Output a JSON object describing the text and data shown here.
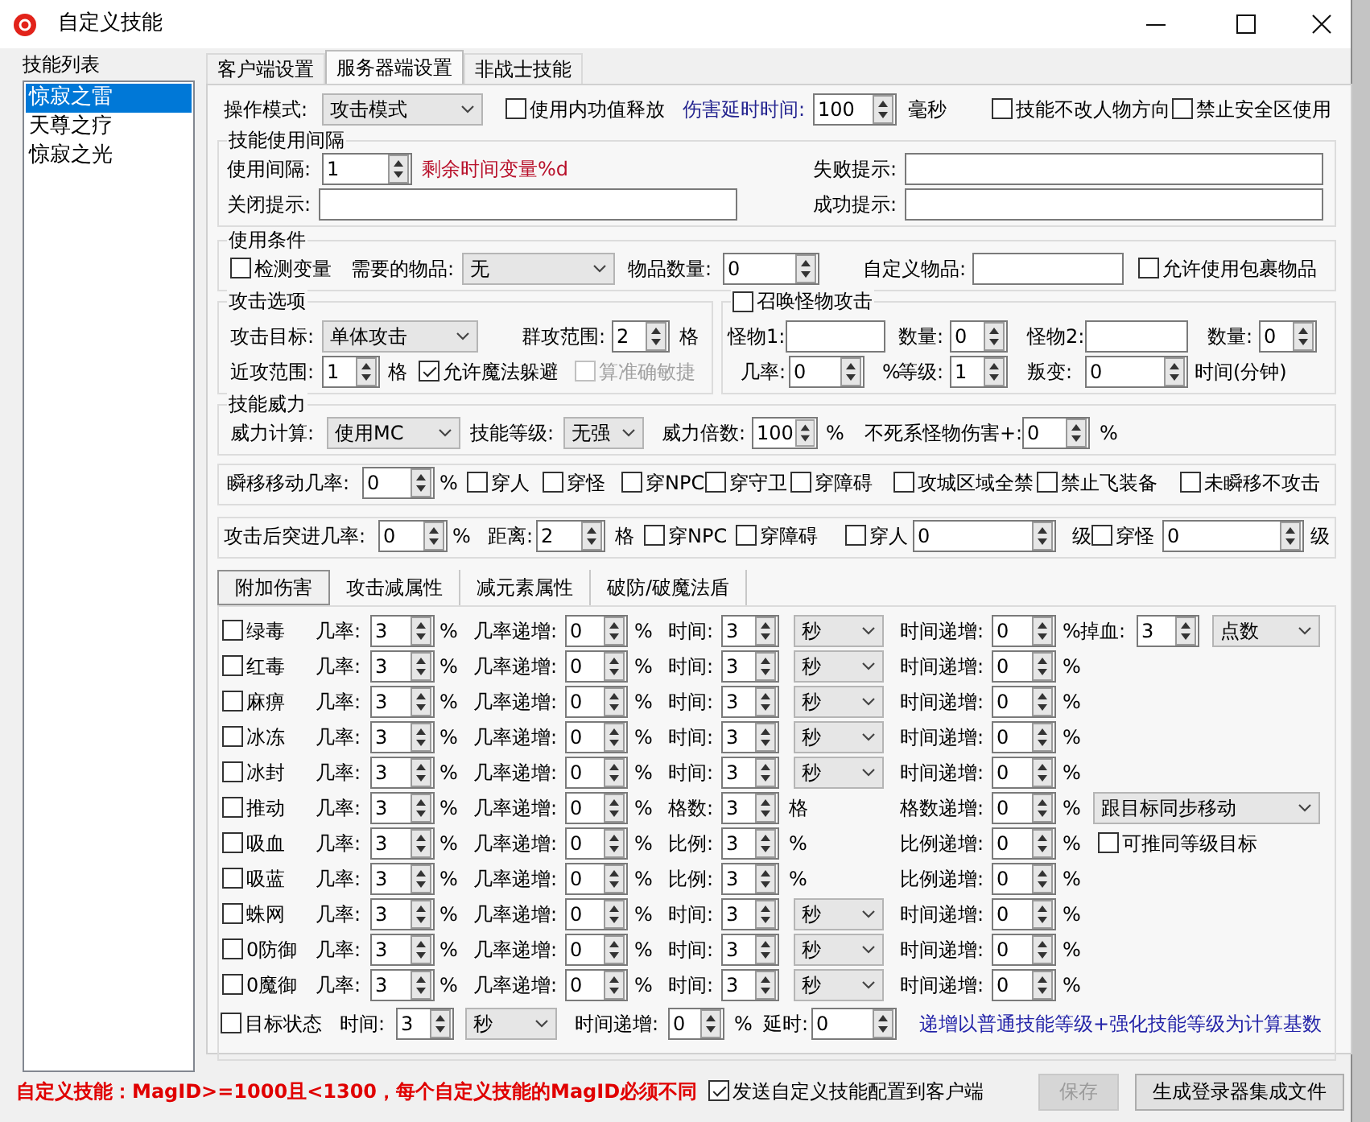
{
  "window": {
    "title": "自定义技能"
  },
  "skill_list": {
    "label": "技能列表",
    "items": [
      {
        "label": "惊寂之雷",
        "selected": true
      },
      {
        "label": "天尊之疗",
        "selected": false
      },
      {
        "label": "惊寂之光",
        "selected": false
      }
    ]
  },
  "tabs": [
    {
      "label": "客户端设置",
      "selected": false
    },
    {
      "label": "服务器端设置",
      "selected": true
    },
    {
      "label": "非战士技能",
      "selected": false
    }
  ],
  "sections": [
    {
      "kind": "plain",
      "rows": [
        [
          {
            "kind": "label",
            "text": "操作模式:"
          },
          {
            "kind": "select",
            "value": "攻击模式"
          },
          {
            "kind": "check",
            "label": "使用内功值释放",
            "checked": false
          },
          {
            "kind": "accent",
            "text": "伤害延时时间:"
          },
          {
            "kind": "spin",
            "value": "100"
          },
          {
            "kind": "unit",
            "text": "毫秒"
          },
          {
            "kind": "check",
            "label": "技能不改人物方向",
            "checked": false
          },
          {
            "kind": "check",
            "label": "禁止安全区使用",
            "checked": false
          }
        ]
      ]
    },
    {
      "kind": "group",
      "title": "技能使用间隔",
      "rows": [
        [
          {
            "kind": "label",
            "text": "使用间隔:"
          },
          {
            "kind": "spin",
            "value": "1"
          },
          {
            "kind": "warning",
            "text": "剩余时间变量%d"
          },
          {
            "kind": "label",
            "text": "失败提示:"
          },
          {
            "kind": "text"
          }
        ],
        [
          {
            "kind": "label",
            "text": "关闭提示:"
          },
          {
            "kind": "text"
          },
          {
            "kind": "gap"
          },
          {
            "kind": "label",
            "text": "成功提示:"
          },
          {
            "kind": "text"
          }
        ]
      ]
    },
    {
      "kind": "group",
      "title": "使用条件",
      "rows": [
        [
          {
            "kind": "check",
            "label": "检测变量",
            "checked": false
          },
          {
            "kind": "label",
            "text": "需要的物品:"
          },
          {
            "kind": "select",
            "value": "无"
          },
          {
            "kind": "label",
            "text": "物品数量:"
          },
          {
            "kind": "spin",
            "value": "0"
          },
          {
            "kind": "label",
            "text": "自定义物品:"
          },
          {
            "kind": "text"
          },
          {
            "kind": "check",
            "label": "允许使用包裹物品",
            "checked": false
          }
        ]
      ]
    },
    {
      "kind": "split",
      "parts": [
        {
          "kind": "group",
          "title": "攻击选项",
          "rows": [
            [
              {
                "kind": "label",
                "text": "攻击目标:"
              },
              {
                "kind": "select",
                "value": "单体攻击"
              },
              {
                "kind": "gap"
              },
              {
                "kind": "label",
                "text": "群攻范围:"
              },
              {
                "kind": "spin",
                "value": "2"
              },
              {
                "kind": "unit",
                "text": "格"
              }
            ],
            [
              {
                "kind": "label",
                "text": "近攻范围:"
              },
              {
                "kind": "spin",
                "value": "1"
              },
              {
                "kind": "unit",
                "text": "格"
              },
              {
                "kind": "check",
                "label": "允许魔法躲避",
                "checked": true,
                "disabled": false
              },
              {
                "kind": "check",
                "label": "算准确敏捷",
                "checked": false,
                "disabled": true
              }
            ]
          ]
        },
        {
          "kind": "check-group",
          "title": {
            "label": "召唤怪物攻击",
            "checked": false
          },
          "rows": [
            [
              {
                "kind": "label",
                "text": "怪物1:"
              },
              {
                "kind": "text"
              },
              {
                "kind": "gap"
              },
              {
                "kind": "label",
                "text": "数量:"
              },
              {
                "kind": "spin",
                "value": "0"
              },
              {
                "kind": "label",
                "text": "怪物2:"
              },
              {
                "kind": "text"
              },
              {
                "kind": "label",
                "text": "数量:"
              },
              {
                "kind": "spin",
                "value": "0"
              }
            ],
            [
              {
                "kind": "label",
                "text": "几率:"
              },
              {
                "kind": "spin",
                "value": "0"
              },
              {
                "kind": "unit",
                "text": "%"
              },
              {
                "kind": "label",
                "text": "等级:"
              },
              {
                "kind": "spin",
                "value": "1"
              },
              {
                "kind": "label",
                "text": "叛变:"
              },
              {
                "kind": "spin",
                "value": "0"
              },
              {
                "kind": "label",
                "text": "时间(分钟)"
              }
            ]
          ]
        }
      ]
    },
    {
      "kind": "group",
      "title": "技能威力",
      "rows": [
        [
          {
            "kind": "label",
            "text": "威力计算:"
          },
          {
            "kind": "select",
            "value": "使用MC"
          },
          {
            "kind": "label",
            "text": "技能等级:"
          },
          {
            "kind": "select",
            "value": "无强"
          },
          {
            "kind": "label",
            "text": "威力倍数:"
          },
          {
            "kind": "spin",
            "value": "100"
          },
          {
            "kind": "unit",
            "text": "%"
          },
          {
            "kind": "label",
            "text": "不死系怪物伤害+:"
          },
          {
            "kind": "spin",
            "value": "0"
          },
          {
            "kind": "unit",
            "text": "%"
          }
        ]
      ]
    },
    {
      "kind": "panel",
      "rows": [
        [
          {
            "kind": "label",
            "text": "瞬移移动几率:"
          },
          {
            "kind": "spin",
            "value": "0"
          },
          {
            "kind": "unit",
            "text": "%"
          },
          {
            "kind": "check",
            "label": "穿人",
            "checked": false
          },
          {
            "kind": "check",
            "label": "穿怪",
            "checked": false
          },
          {
            "kind": "check",
            "label": "穿NPC",
            "checked": false
          },
          {
            "kind": "check",
            "label": "穿守卫",
            "checked": false
          },
          {
            "kind": "check",
            "label": "穿障碍",
            "checked": false
          },
          {
            "kind": "check",
            "label": "攻城区域全禁",
            "checked": false
          },
          {
            "kind": "check",
            "label": "禁止飞装备",
            "checked": false
          },
          {
            "kind": "check",
            "label": "未瞬移不攻击",
            "checked": false
          }
        ]
      ]
    },
    {
      "kind": "panel",
      "rows": [
        [
          {
            "kind": "label",
            "text": "攻击后突进几率:"
          },
          {
            "kind": "spin",
            "value": "0"
          },
          {
            "kind": "unit",
            "text": "%"
          },
          {
            "kind": "label",
            "text": "距离:"
          },
          {
            "kind": "spin",
            "value": "2"
          },
          {
            "kind": "unit",
            "text": "格"
          },
          {
            "kind": "check",
            "label": "穿NPC",
            "checked": false
          },
          {
            "kind": "check",
            "label": "穿障碍",
            "checked": false
          },
          {
            "kind": "check",
            "label": "穿人",
            "checked": false
          },
          {
            "kind": "spin",
            "value": "0"
          },
          {
            "kind": "unit",
            "text": "级"
          },
          {
            "kind": "check",
            "label": "穿怪",
            "checked": false
          },
          {
            "kind": "spin",
            "value": "0"
          },
          {
            "kind": "unit",
            "text": "级"
          }
        ]
      ]
    }
  ],
  "subtabs": [
    {
      "label": "附加伤害",
      "selected": true
    },
    {
      "label": "攻击减属性",
      "selected": false
    },
    {
      "label": "减元素属性",
      "selected": false
    },
    {
      "label": "破防/破魔法盾",
      "selected": false
    }
  ],
  "effects": [
    {
      "name": "绿毒",
      "checked": false,
      "fields": [
        {
          "label": "几率:",
          "value": "3",
          "unit": "%"
        },
        {
          "label": "几率递增:",
          "value": "0",
          "unit": "%"
        },
        {
          "label": "时间:",
          "value": "3",
          "select": "秒"
        },
        {
          "label": "时间递增:",
          "value": "0",
          "unit": "%"
        }
      ],
      "extra": {
        "kind": "drain",
        "label": "掉血:",
        "value": "3",
        "select": "点数"
      }
    },
    {
      "name": "红毒",
      "checked": false,
      "fields": [
        {
          "label": "几率:",
          "value": "3",
          "unit": "%"
        },
        {
          "label": "几率递增:",
          "value": "0",
          "unit": "%"
        },
        {
          "label": "时间:",
          "value": "3",
          "select": "秒"
        },
        {
          "label": "时间递增:",
          "value": "0",
          "unit": "%"
        }
      ]
    },
    {
      "name": "麻痹",
      "checked": false,
      "fields": [
        {
          "label": "几率:",
          "value": "3",
          "unit": "%"
        },
        {
          "label": "几率递增:",
          "value": "0",
          "unit": "%"
        },
        {
          "label": "时间:",
          "value": "3",
          "select": "秒"
        },
        {
          "label": "时间递增:",
          "value": "0",
          "unit": "%"
        }
      ]
    },
    {
      "name": "冰冻",
      "checked": false,
      "fields": [
        {
          "label": "几率:",
          "value": "3",
          "unit": "%"
        },
        {
          "label": "几率递增:",
          "value": "0",
          "unit": "%"
        },
        {
          "label": "时间:",
          "value": "3",
          "select": "秒"
        },
        {
          "label": "时间递增:",
          "value": "0",
          "unit": "%"
        }
      ]
    },
    {
      "name": "冰封",
      "checked": false,
      "fields": [
        {
          "label": "几率:",
          "value": "3",
          "unit": "%"
        },
        {
          "label": "几率递增:",
          "value": "0",
          "unit": "%"
        },
        {
          "label": "时间:",
          "value": "3",
          "select": "秒"
        },
        {
          "label": "时间递增:",
          "value": "0",
          "unit": "%"
        }
      ]
    },
    {
      "name": "推动",
      "checked": false,
      "fields": [
        {
          "label": "几率:",
          "value": "3",
          "unit": "%"
        },
        {
          "label": "几率递增:",
          "value": "0",
          "unit": "%"
        },
        {
          "label": "格数:",
          "value": "3",
          "unit": "格"
        },
        {
          "label": "格数递增:",
          "value": "0",
          "unit": "%"
        }
      ],
      "extra": {
        "kind": "select",
        "value": "跟目标同步移动"
      }
    },
    {
      "name": "吸血",
      "checked": false,
      "fields": [
        {
          "label": "几率:",
          "value": "3",
          "unit": "%"
        },
        {
          "label": "几率递增:",
          "value": "0",
          "unit": "%"
        },
        {
          "label": "比例:",
          "value": "3",
          "unit": "%"
        },
        {
          "label": "比例递增:",
          "value": "0",
          "unit": "%"
        }
      ],
      "extra": {
        "kind": "check",
        "label": "可推同等级目标",
        "checked": false
      }
    },
    {
      "name": "吸蓝",
      "checked": false,
      "fields": [
        {
          "label": "几率:",
          "value": "3",
          "unit": "%"
        },
        {
          "label": "几率递增:",
          "value": "0",
          "unit": "%"
        },
        {
          "label": "比例:",
          "value": "3",
          "unit": "%"
        },
        {
          "label": "比例递增:",
          "value": "0",
          "unit": "%"
        }
      ]
    },
    {
      "name": "蛛网",
      "checked": false,
      "fields": [
        {
          "label": "几率:",
          "value": "3",
          "unit": "%"
        },
        {
          "label": "几率递增:",
          "value": "0",
          "unit": "%"
        },
        {
          "label": "时间:",
          "value": "3",
          "select": "秒"
        },
        {
          "label": "时间递增:",
          "value": "0",
          "unit": "%"
        }
      ]
    },
    {
      "name": "0防御",
      "checked": false,
      "fields": [
        {
          "label": "几率:",
          "value": "3",
          "unit": "%"
        },
        {
          "label": "几率递增:",
          "value": "0",
          "unit": "%"
        },
        {
          "label": "时间:",
          "value": "3",
          "select": "秒"
        },
        {
          "label": "时间递增:",
          "value": "0",
          "unit": "%"
        }
      ]
    },
    {
      "name": "0魔御",
      "checked": false,
      "fields": [
        {
          "label": "几率:",
          "value": "3",
          "unit": "%"
        },
        {
          "label": "几率递增:",
          "value": "0",
          "unit": "%"
        },
        {
          "label": "时间:",
          "value": "3",
          "select": "秒"
        },
        {
          "label": "时间递增:",
          "value": "0",
          "unit": "%"
        }
      ]
    }
  ],
  "status_row": [
    {
      "kind": "check",
      "label": "目标状态",
      "checked": false
    },
    {
      "kind": "label",
      "text": "时间:"
    },
    {
      "kind": "spin",
      "value": "3"
    },
    {
      "kind": "select",
      "value": "秒"
    },
    {
      "kind": "label",
      "text": "时间递增:"
    },
    {
      "kind": "spin",
      "value": "0"
    },
    {
      "kind": "unit",
      "text": "%"
    },
    {
      "kind": "label",
      "text": "延时:"
    },
    {
      "kind": "spin",
      "value": "0"
    },
    {
      "kind": "info",
      "text": "递增以普通技能等级+强化技能等级为计算基数"
    }
  ],
  "footer": {
    "notice": "自定义技能：MagID>=1000且<1300，每个自定义技能的MagID必须不同",
    "send_config": {
      "label": "发送自定义技能配置到客户端",
      "checked": true
    },
    "buttons": [
      {
        "label": "保存",
        "disabled": true
      },
      {
        "label": "生成登录器集成文件",
        "disabled": false
      }
    ]
  }
}
